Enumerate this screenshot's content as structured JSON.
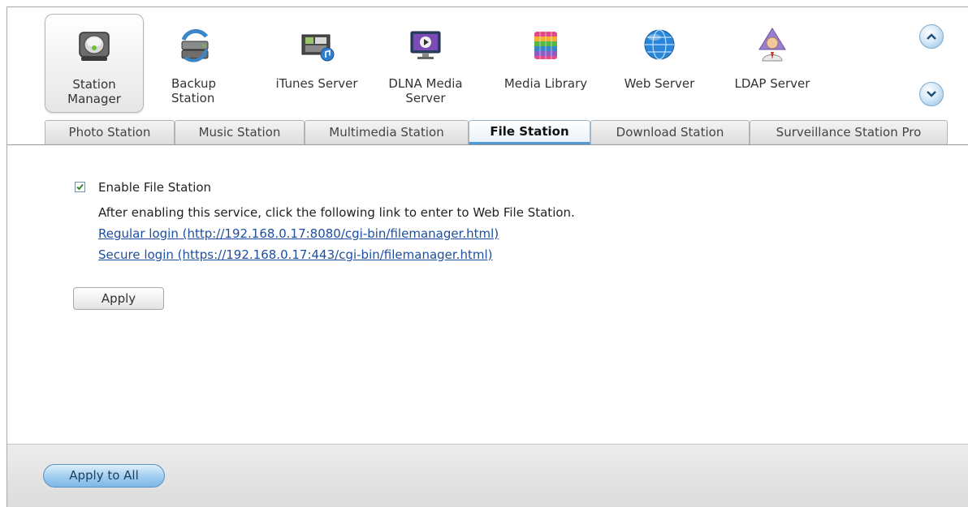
{
  "toolbar": {
    "items": [
      {
        "label": "Station\nManager",
        "icon": "station-manager-icon",
        "selected": true
      },
      {
        "label": "Backup\nStation",
        "icon": "backup-station-icon"
      },
      {
        "label": "iTunes Server",
        "icon": "itunes-server-icon"
      },
      {
        "label": "DLNA Media\nServer",
        "icon": "dlna-media-server-icon"
      },
      {
        "label": "Media Library",
        "icon": "media-library-icon"
      },
      {
        "label": "Web Server",
        "icon": "web-server-icon"
      },
      {
        "label": "LDAP Server",
        "icon": "ldap-server-icon"
      }
    ],
    "scroll_up_icon": "chevron-up-icon",
    "scroll_down_icon": "chevron-down-icon"
  },
  "tabs": [
    {
      "label": "Photo Station"
    },
    {
      "label": "Music Station"
    },
    {
      "label": "Multimedia Station"
    },
    {
      "label": "File Station",
      "active": true
    },
    {
      "label": "Download Station"
    },
    {
      "label": "Surveillance Station Pro"
    }
  ],
  "content": {
    "enable_label": "Enable File Station",
    "enable_checked": true,
    "description": "After enabling this service, click the following link to enter to Web File Station.",
    "regular_login": "Regular login (http://192.168.0.17:8080/cgi-bin/filemanager.html)",
    "secure_login": "Secure login (https://192.168.0.17:443/cgi-bin/filemanager.html)",
    "apply_label": "Apply"
  },
  "footer": {
    "apply_all_label": "Apply to All"
  },
  "colors": {
    "accent": "#4d9ad6",
    "link": "#1d4fa0",
    "check": "#2e8b2e"
  }
}
